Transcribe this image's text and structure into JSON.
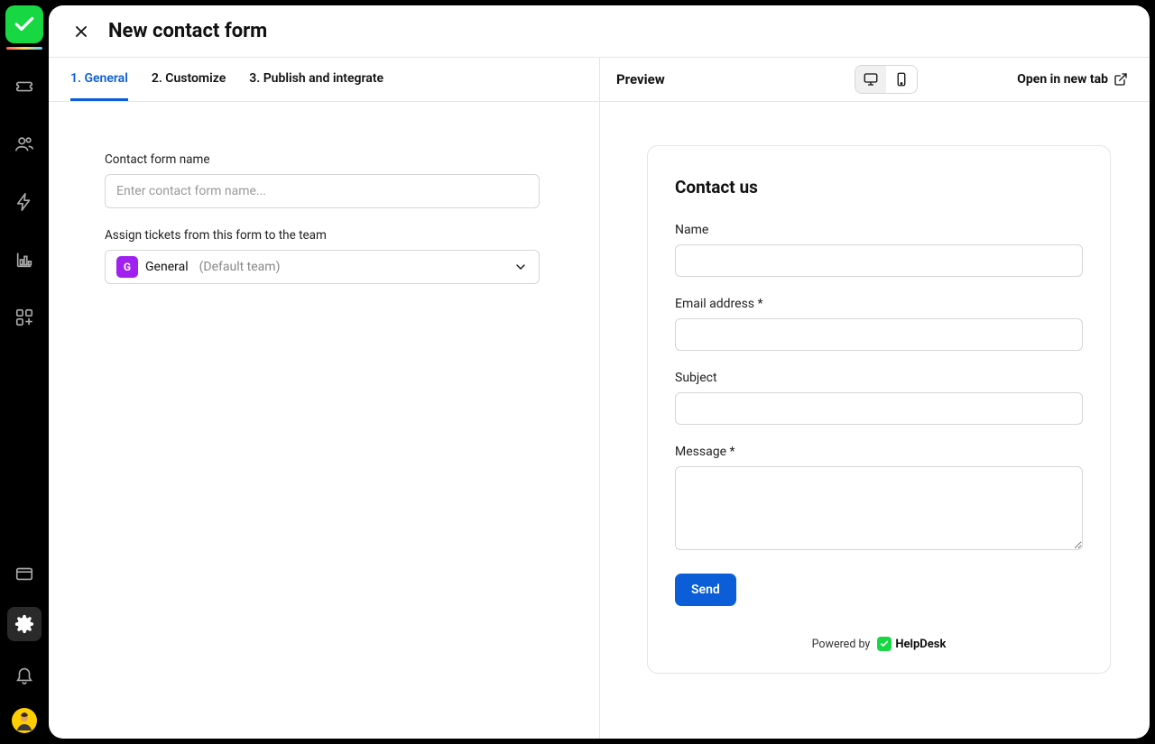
{
  "header": {
    "title": "New contact form"
  },
  "tabs": {
    "general": "1. General",
    "customize": "2. Customize",
    "publish": "3. Publish and integrate"
  },
  "previewBar": {
    "label": "Preview",
    "openNewTab": "Open in new tab"
  },
  "settings": {
    "nameLabel": "Contact form name",
    "namePlaceholder": "Enter contact form name...",
    "assignLabel": "Assign tickets from this form to the team",
    "teamBadge": "G",
    "teamName": "General",
    "teamSuffix": "(Default team)"
  },
  "previewForm": {
    "title": "Contact us",
    "nameLabel": "Name",
    "emailLabel": "Email address *",
    "subjectLabel": "Subject",
    "messageLabel": "Message *",
    "sendLabel": "Send",
    "poweredBy": "Powered by",
    "brand": "HelpDesk"
  }
}
